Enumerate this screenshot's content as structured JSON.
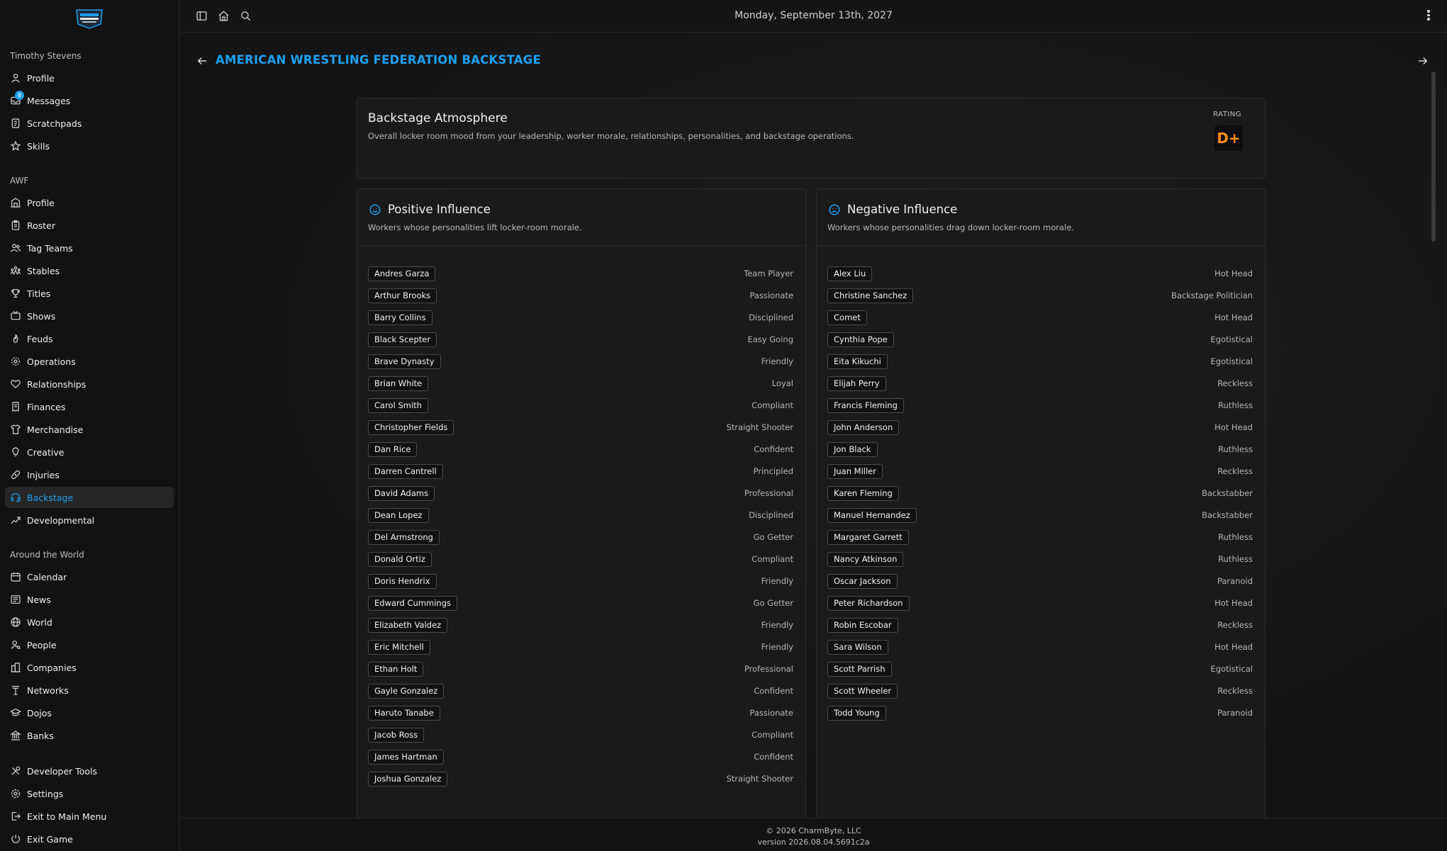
{
  "sidebar": {
    "user_section_title": "Timothy Stevens",
    "user_items": [
      {
        "label": "Profile",
        "icon": "user-icon"
      },
      {
        "label": "Messages",
        "icon": "inbox-icon",
        "badge": "8"
      },
      {
        "label": "Scratchpads",
        "icon": "notepad-icon"
      },
      {
        "label": "Skills",
        "icon": "star-icon"
      }
    ],
    "company_section_title": "AWF",
    "company_items": [
      {
        "label": "Profile",
        "icon": "building-icon"
      },
      {
        "label": "Roster",
        "icon": "clipboard-icon"
      },
      {
        "label": "Tag Teams",
        "icon": "users-icon"
      },
      {
        "label": "Stables",
        "icon": "group-icon"
      },
      {
        "label": "Titles",
        "icon": "trophy-icon"
      },
      {
        "label": "Shows",
        "icon": "tv-icon"
      },
      {
        "label": "Feuds",
        "icon": "flame-icon"
      },
      {
        "label": "Operations",
        "icon": "gear-icon"
      },
      {
        "label": "Relationships",
        "icon": "heart-icon"
      },
      {
        "label": "Finances",
        "icon": "receipt-icon"
      },
      {
        "label": "Merchandise",
        "icon": "shirt-icon"
      },
      {
        "label": "Creative",
        "icon": "lightbulb-icon"
      },
      {
        "label": "Injuries",
        "icon": "bandage-icon"
      },
      {
        "label": "Backstage",
        "icon": "headset-icon",
        "active": true
      },
      {
        "label": "Developmental",
        "icon": "trend-icon"
      }
    ],
    "world_section_title": "Around the World",
    "world_items": [
      {
        "label": "Calendar",
        "icon": "calendar-icon"
      },
      {
        "label": "News",
        "icon": "newspaper-icon"
      },
      {
        "label": "World",
        "icon": "globe-icon"
      },
      {
        "label": "People",
        "icon": "person-search-icon"
      },
      {
        "label": "Companies",
        "icon": "companies-icon"
      },
      {
        "label": "Networks",
        "icon": "antenna-icon"
      },
      {
        "label": "Dojos",
        "icon": "graduation-icon"
      },
      {
        "label": "Banks",
        "icon": "bank-icon"
      }
    ],
    "bottom_items": [
      {
        "label": "Developer Tools",
        "icon": "tools-icon"
      },
      {
        "label": "Settings",
        "icon": "settings-icon"
      },
      {
        "label": "Exit to Main Menu",
        "icon": "exit-icon"
      },
      {
        "label": "Exit Game",
        "icon": "power-icon"
      }
    ]
  },
  "topbar": {
    "date": "Monday, September 13th, 2027"
  },
  "page": {
    "title": "AMERICAN WRESTLING FEDERATION BACKSTAGE"
  },
  "atmosphere": {
    "title": "Backstage Atmosphere",
    "description": "Overall locker room mood from your leadership, worker morale, relationships, personalities, and backstage operations.",
    "rating_label": "RATING",
    "rating": "D+",
    "rating_color": "#ff8c1a"
  },
  "positive": {
    "title": "Positive Influence",
    "description": "Workers whose personalities lift locker-room morale.",
    "workers": [
      {
        "name": "Andres Garza",
        "trait": "Team Player"
      },
      {
        "name": "Arthur Brooks",
        "trait": "Passionate"
      },
      {
        "name": "Barry Collins",
        "trait": "Disciplined"
      },
      {
        "name": "Black Scepter",
        "trait": "Easy Going"
      },
      {
        "name": "Brave Dynasty",
        "trait": "Friendly"
      },
      {
        "name": "Brian White",
        "trait": "Loyal"
      },
      {
        "name": "Carol Smith",
        "trait": "Compliant"
      },
      {
        "name": "Christopher Fields",
        "trait": "Straight Shooter"
      },
      {
        "name": "Dan Rice",
        "trait": "Confident"
      },
      {
        "name": "Darren Cantrell",
        "trait": "Principled"
      },
      {
        "name": "David Adams",
        "trait": "Professional"
      },
      {
        "name": "Dean Lopez",
        "trait": "Disciplined"
      },
      {
        "name": "Del Armstrong",
        "trait": "Go Getter"
      },
      {
        "name": "Donald Ortiz",
        "trait": "Compliant"
      },
      {
        "name": "Doris Hendrix",
        "trait": "Friendly"
      },
      {
        "name": "Edward Cummings",
        "trait": "Go Getter"
      },
      {
        "name": "Elizabeth Valdez",
        "trait": "Friendly"
      },
      {
        "name": "Eric Mitchell",
        "trait": "Friendly"
      },
      {
        "name": "Ethan Holt",
        "trait": "Professional"
      },
      {
        "name": "Gayle Gonzalez",
        "trait": "Confident"
      },
      {
        "name": "Haruto Tanabe",
        "trait": "Passionate"
      },
      {
        "name": "Jacob Ross",
        "trait": "Compliant"
      },
      {
        "name": "James Hartman",
        "trait": "Confident"
      },
      {
        "name": "Joshua Gonzalez",
        "trait": "Straight Shooter"
      }
    ]
  },
  "negative": {
    "title": "Negative Influence",
    "description": "Workers whose personalities drag down locker-room morale.",
    "workers": [
      {
        "name": "Alex Liu",
        "trait": "Hot Head"
      },
      {
        "name": "Christine Sanchez",
        "trait": "Backstage Politician"
      },
      {
        "name": "Comet",
        "trait": "Hot Head"
      },
      {
        "name": "Cynthia Pope",
        "trait": "Egotistical"
      },
      {
        "name": "Eita Kikuchi",
        "trait": "Egotistical"
      },
      {
        "name": "Elijah Perry",
        "trait": "Reckless"
      },
      {
        "name": "Francis Fleming",
        "trait": "Ruthless"
      },
      {
        "name": "John Anderson",
        "trait": "Hot Head"
      },
      {
        "name": "Jon Black",
        "trait": "Ruthless"
      },
      {
        "name": "Juan Miller",
        "trait": "Reckless"
      },
      {
        "name": "Karen Fleming",
        "trait": "Backstabber"
      },
      {
        "name": "Manuel Hernandez",
        "trait": "Backstabber"
      },
      {
        "name": "Margaret Garrett",
        "trait": "Ruthless"
      },
      {
        "name": "Nancy Atkinson",
        "trait": "Ruthless"
      },
      {
        "name": "Oscar Jackson",
        "trait": "Paranoid"
      },
      {
        "name": "Peter Richardson",
        "trait": "Hot Head"
      },
      {
        "name": "Robin Escobar",
        "trait": "Reckless"
      },
      {
        "name": "Sara Wilson",
        "trait": "Hot Head"
      },
      {
        "name": "Scott Parrish",
        "trait": "Egotistical"
      },
      {
        "name": "Scott Wheeler",
        "trait": "Reckless"
      },
      {
        "name": "Todd Young",
        "trait": "Paranoid"
      }
    ]
  },
  "footer": {
    "copyright": "© 2026 CharmByte, LLC",
    "version": "version 2026.08.04.5691c2a"
  },
  "colors": {
    "accent": "#1da1f2",
    "background": "#161616",
    "rating": "#ff8c1a"
  }
}
